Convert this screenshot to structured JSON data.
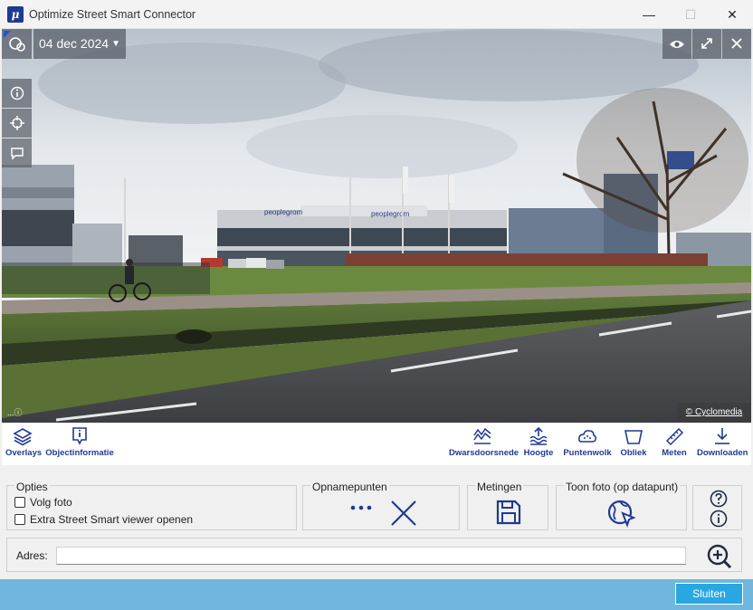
{
  "window": {
    "title": "Optimize Street Smart Connector",
    "app_icon_glyph": "μ",
    "minimize_glyph": "—",
    "maximize_glyph": "☐",
    "close_glyph": "✕"
  },
  "viewer": {
    "date": "04 dec 2024",
    "scale_indicator": "...ⓘ",
    "credit": "© Cyclomedia",
    "left_tools": [
      "info-icon",
      "locate-icon",
      "comment-icon"
    ],
    "right_tools": [
      "eye-icon",
      "expand-icon",
      "close-icon"
    ]
  },
  "toolbar": {
    "left": [
      {
        "label": "Overlays",
        "icon": "layers-icon"
      },
      {
        "label": "Objectinformatie",
        "icon": "object-info-icon"
      }
    ],
    "right": [
      {
        "label": "Dwarsdoorsnede",
        "icon": "cross-section-icon"
      },
      {
        "label": "Hoogte",
        "icon": "height-icon"
      },
      {
        "label": "Puntenwolk",
        "icon": "point-cloud-icon"
      },
      {
        "label": "Obliek",
        "icon": "oblique-icon"
      },
      {
        "label": "Meten",
        "icon": "ruler-icon"
      },
      {
        "label": "Downloaden",
        "icon": "download-icon"
      }
    ]
  },
  "options": {
    "title": "Opties",
    "volg_foto": "Volg foto",
    "extra_viewer": "Extra Street Smart viewer openen"
  },
  "opnamepunten": {
    "title": "Opnamepunten"
  },
  "metingen": {
    "title": "Metingen"
  },
  "toon_foto": {
    "title": "Toon foto (op datapunt)"
  },
  "address": {
    "label": "Adres:",
    "value": ""
  },
  "footer": {
    "close_label": "Sluiten"
  },
  "colors": {
    "accent": "#1f3a93",
    "footer": "#6fb7de",
    "button": "#2aa7e0"
  }
}
